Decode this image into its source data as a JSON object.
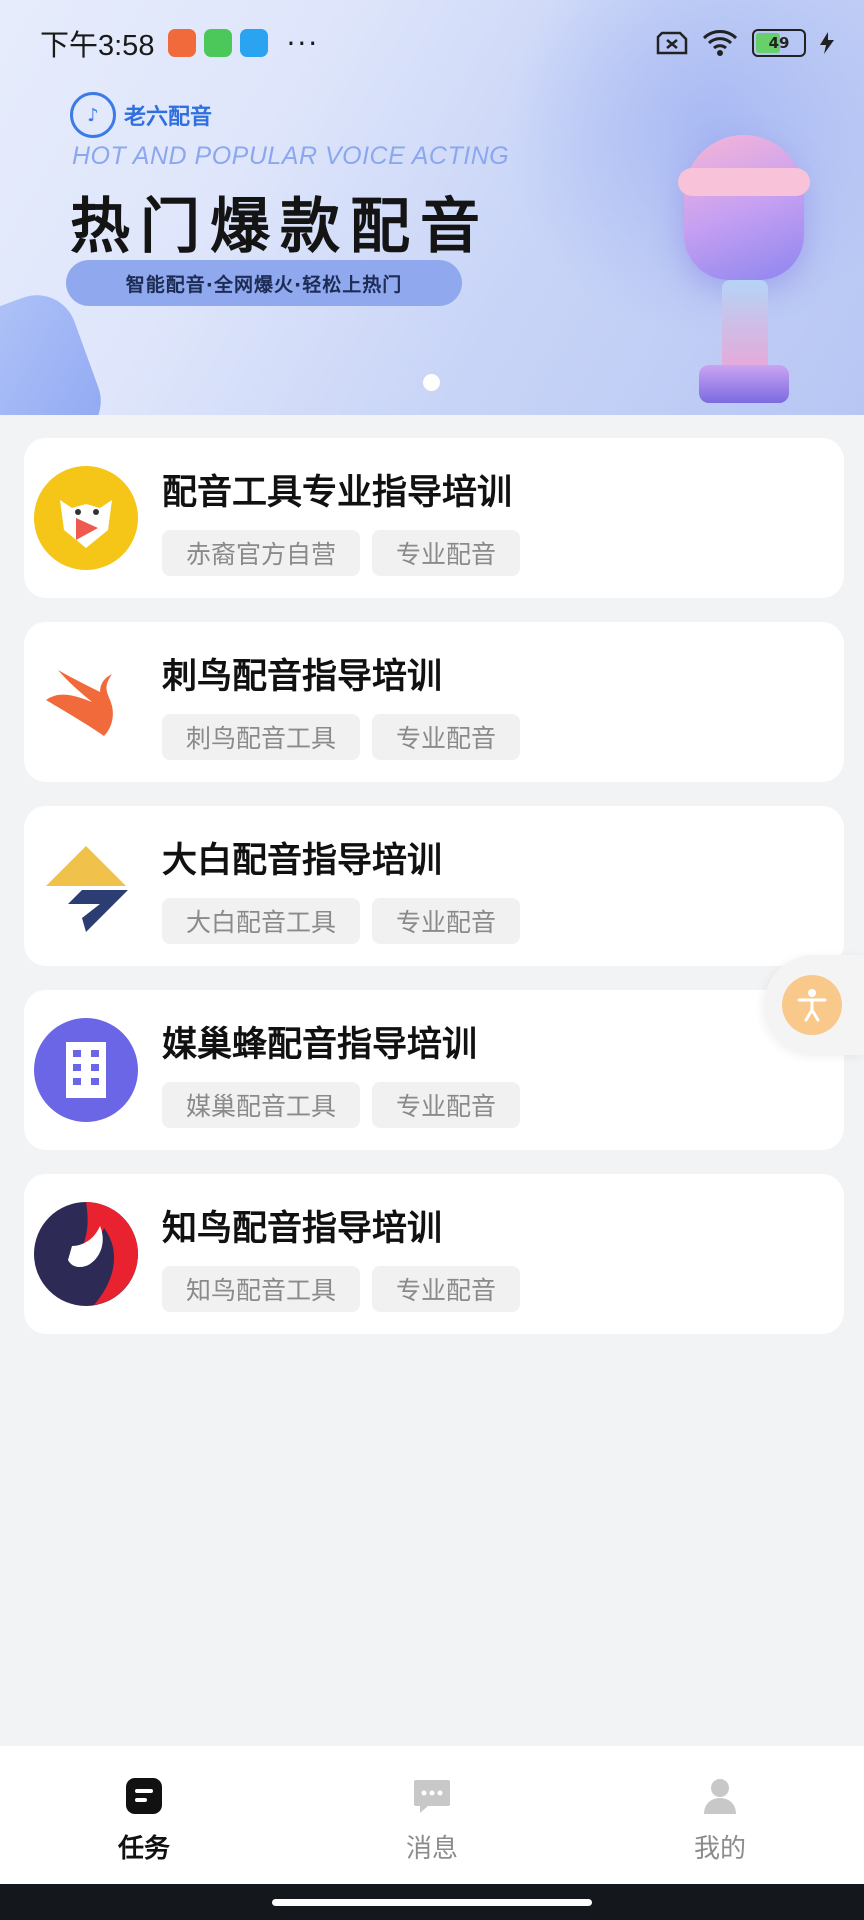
{
  "status_bar": {
    "time": "下午3:58",
    "battery": "49",
    "more": "···"
  },
  "banner": {
    "brand": "老六配音",
    "subtitle_en": "HOT AND POPULAR VOICE ACTING",
    "title": "热门爆款配音",
    "tagline": "智能配音·全网爆火·轻松上热门"
  },
  "items": [
    {
      "title": "配音工具专业指导培训",
      "tags": [
        "赤裔官方自营",
        "专业配音"
      ],
      "logo_icon": "cat-mascot-icon",
      "logo_color": "#f5c518"
    },
    {
      "title": "刺鸟配音指导培训",
      "tags": [
        "刺鸟配音工具",
        "专业配音"
      ],
      "logo_icon": "swift-bird-icon",
      "logo_color": "#f06a3b"
    },
    {
      "title": "大白配音指导培训",
      "tags": [
        "大白配音工具",
        "专业配音"
      ],
      "logo_icon": "dabai-logo-icon",
      "logo_color": "#f0c24b"
    },
    {
      "title": "媒巢蜂配音指导培训",
      "tags": [
        "媒巢配音工具",
        "专业配音"
      ],
      "logo_icon": "building-icon",
      "logo_color": "#6b66e6"
    },
    {
      "title": "知鸟配音指导培训",
      "tags": [
        "知鸟配音工具",
        "专业配音"
      ],
      "logo_icon": "zhiniao-bird-icon",
      "logo_color": "#2d2a55"
    }
  ],
  "tabs": [
    {
      "label": "任务",
      "icon": "task-icon",
      "active": true
    },
    {
      "label": "消息",
      "icon": "message-icon",
      "active": false
    },
    {
      "label": "我的",
      "icon": "profile-icon",
      "active": false
    }
  ]
}
